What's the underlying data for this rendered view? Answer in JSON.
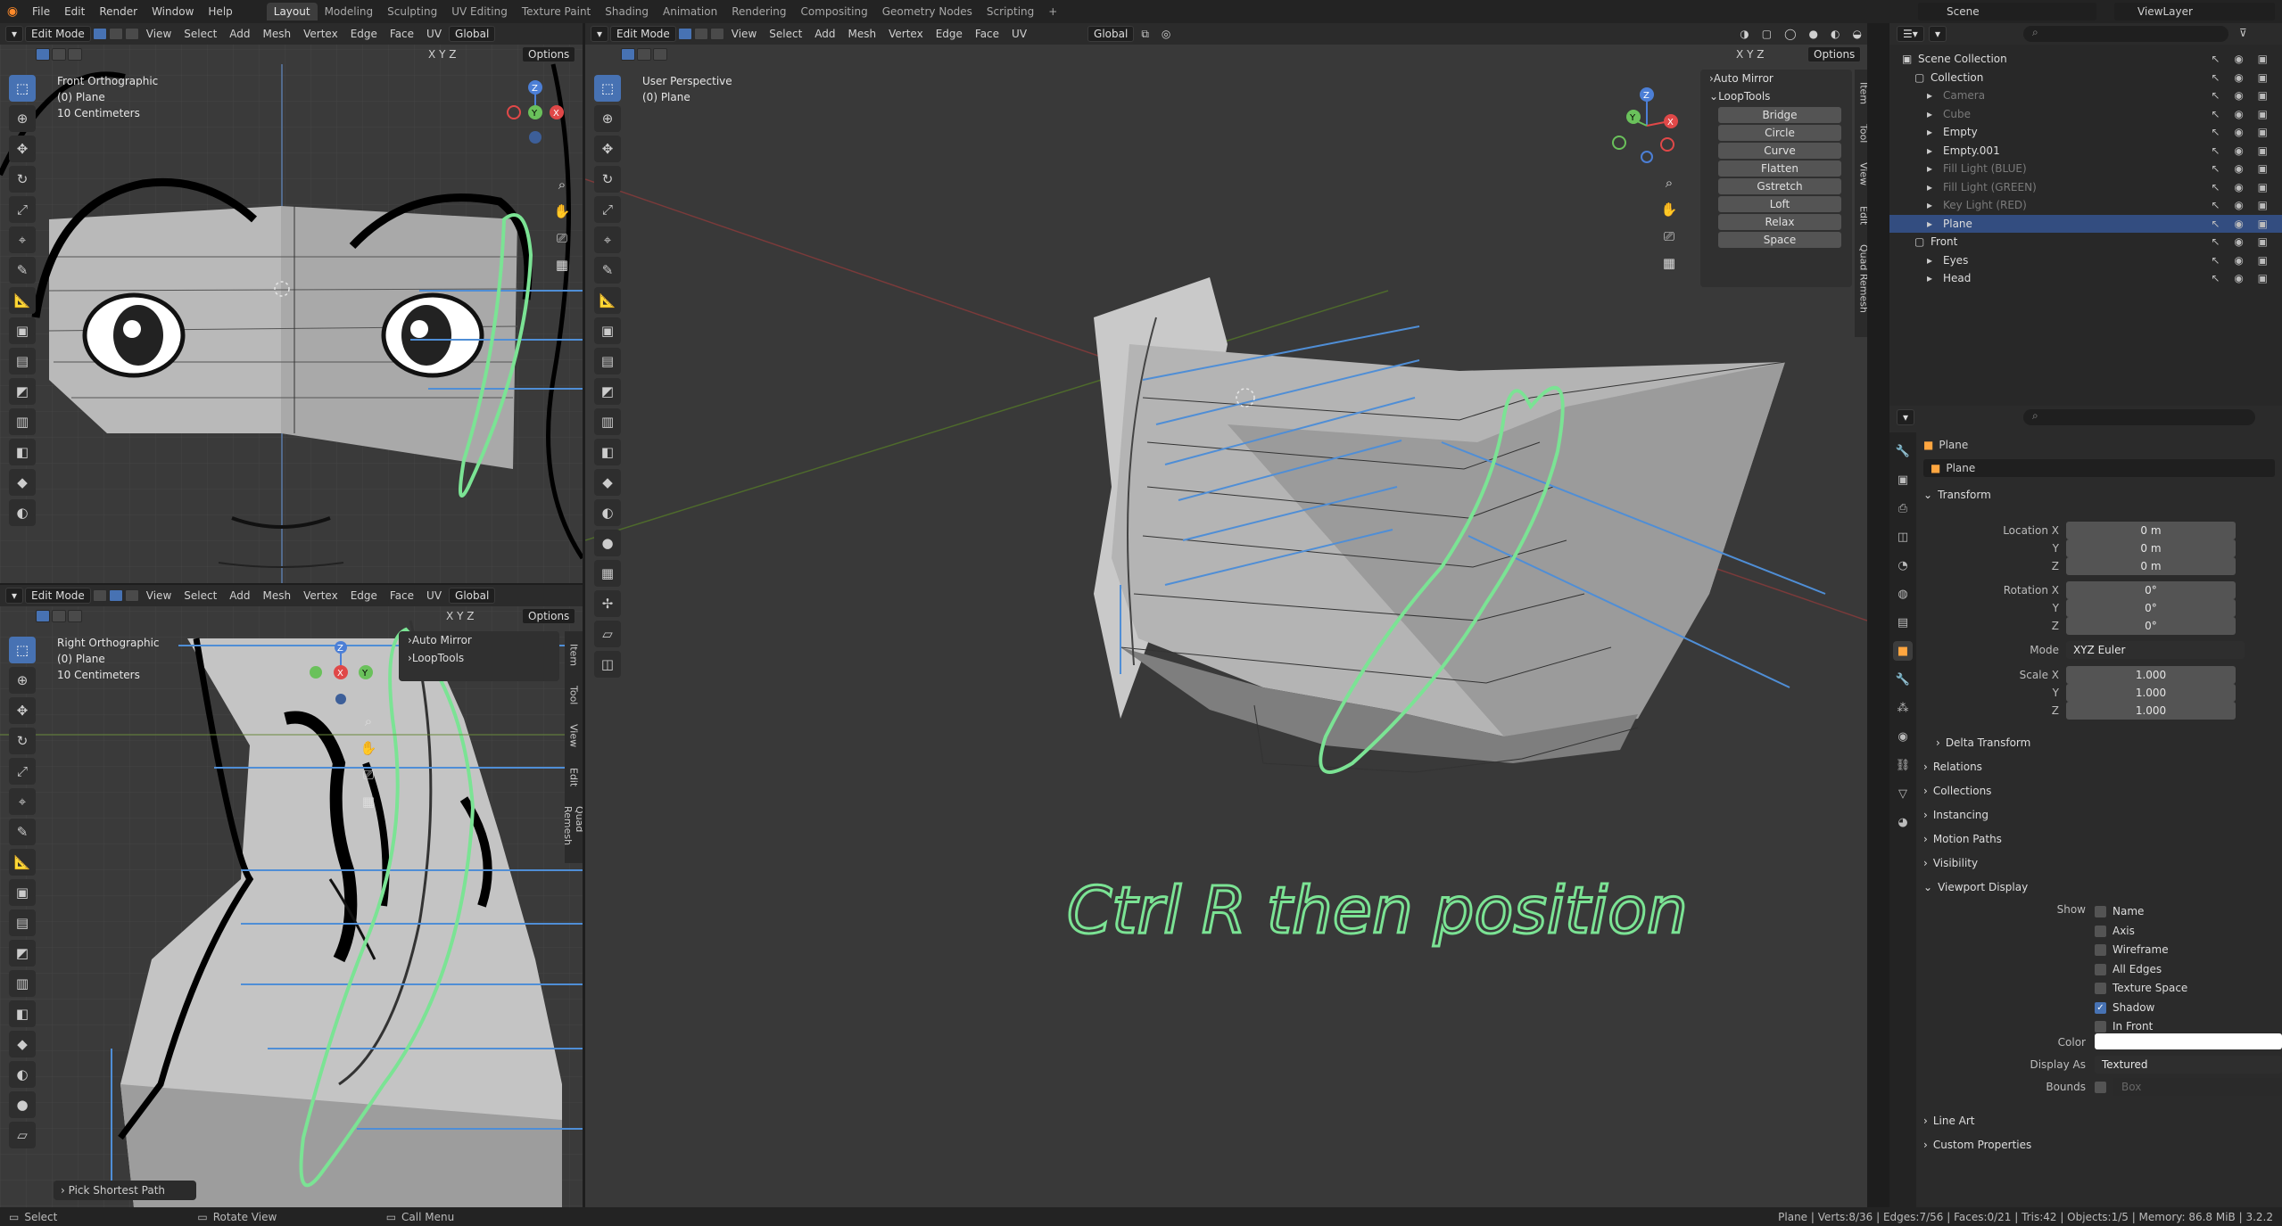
{
  "topbar": {
    "menus": [
      "File",
      "Edit",
      "Render",
      "Window",
      "Help"
    ],
    "workspaces": [
      "Layout",
      "Modeling",
      "Sculpting",
      "UV Editing",
      "Texture Paint",
      "Shading",
      "Animation",
      "Rendering",
      "Compositing",
      "Geometry Nodes",
      "Scripting"
    ],
    "active_workspace": "Layout",
    "scene": "Scene",
    "view_layer": "ViewLayer"
  },
  "viewport_header": {
    "mode": "Edit Mode",
    "menus": [
      "View",
      "Select",
      "Add",
      "Mesh",
      "Vertex",
      "Edge",
      "Face",
      "UV"
    ],
    "orientation": "Global",
    "options": "Options"
  },
  "vp_front": {
    "title": "Front Orthographic",
    "object": "(0) Plane",
    "scale": "10 Centimeters"
  },
  "vp_right": {
    "title": "Right Orthographic",
    "object": "(0) Plane",
    "scale": "10 Centimeters",
    "popup": "Pick Shortest Path"
  },
  "vp_persp": {
    "title": "User Perspective",
    "object": "(0) Plane"
  },
  "npanel": {
    "auto_mirror": "Auto Mirror",
    "looptools": "LoopTools",
    "buttons": [
      "Bridge",
      "Circle",
      "Curve",
      "Flatten",
      "Gstretch",
      "Loft",
      "Relax",
      "Space"
    ]
  },
  "sidetabs": [
    "Item",
    "Tool",
    "View",
    "Edit",
    "Quad Remesh"
  ],
  "axes": {
    "x": "X",
    "y": "Y",
    "z": "Z"
  },
  "annotation": "Ctrl R then position",
  "outliner": {
    "rows": [
      {
        "label": "Scene Collection",
        "indent": 0,
        "dim": false
      },
      {
        "label": "Collection",
        "indent": 1,
        "dim": false
      },
      {
        "label": "Camera",
        "indent": 2,
        "dim": true
      },
      {
        "label": "Cube",
        "indent": 2,
        "dim": true
      },
      {
        "label": "Empty",
        "indent": 2,
        "dim": false
      },
      {
        "label": "Empty.001",
        "indent": 2,
        "dim": false
      },
      {
        "label": "Fill Light (BLUE)",
        "indent": 2,
        "dim": true
      },
      {
        "label": "Fill Light (GREEN)",
        "indent": 2,
        "dim": true
      },
      {
        "label": "Key Light (RED)",
        "indent": 2,
        "dim": true
      },
      {
        "label": "Plane",
        "indent": 2,
        "dim": false,
        "selected": true
      },
      {
        "label": "Front",
        "indent": 1,
        "dim": false
      },
      {
        "label": "Eyes",
        "indent": 2,
        "dim": false
      },
      {
        "label": "Head",
        "indent": 2,
        "dim": false
      }
    ]
  },
  "properties": {
    "object_name": "Plane",
    "data_name": "Plane",
    "transform": "Transform",
    "location_label": "Location X",
    "location": [
      "0 m",
      "0 m",
      "0 m"
    ],
    "rotation_label": "Rotation X",
    "rotation": [
      "0°",
      "0°",
      "0°"
    ],
    "mode_label": "Mode",
    "mode": "XYZ Euler",
    "scale_label": "Scale X",
    "scale": [
      "1.000",
      "1.000",
      "1.000"
    ],
    "axis_y": "Y",
    "axis_z": "Z",
    "sections": [
      "Delta Transform",
      "Relations",
      "Collections",
      "Instancing",
      "Motion Paths",
      "Visibility"
    ],
    "viewport_display": "Viewport Display",
    "show_label": "Show",
    "show": [
      {
        "label": "Name",
        "on": false
      },
      {
        "label": "Axis",
        "on": false
      },
      {
        "label": "Wireframe",
        "on": false
      },
      {
        "label": "All Edges",
        "on": false
      },
      {
        "label": "Texture Space",
        "on": false
      },
      {
        "label": "Shadow",
        "on": true
      },
      {
        "label": "In Front",
        "on": false
      }
    ],
    "color_label": "Color",
    "color": "#ffffff",
    "display_as_label": "Display As",
    "display_as": "Textured",
    "bounds_label": "Bounds",
    "bounds": "Box",
    "sections_after": [
      "Line Art",
      "Custom Properties"
    ]
  },
  "statusbar": {
    "select": "Select",
    "rotate": "Rotate View",
    "call_menu": "Call Menu",
    "stats": "Plane | Verts:8/36 | Edges:7/56 | Faces:0/21 | Tris:42 | Objects:1/5 | Memory: 86.8 MiB | 3.2.2"
  }
}
